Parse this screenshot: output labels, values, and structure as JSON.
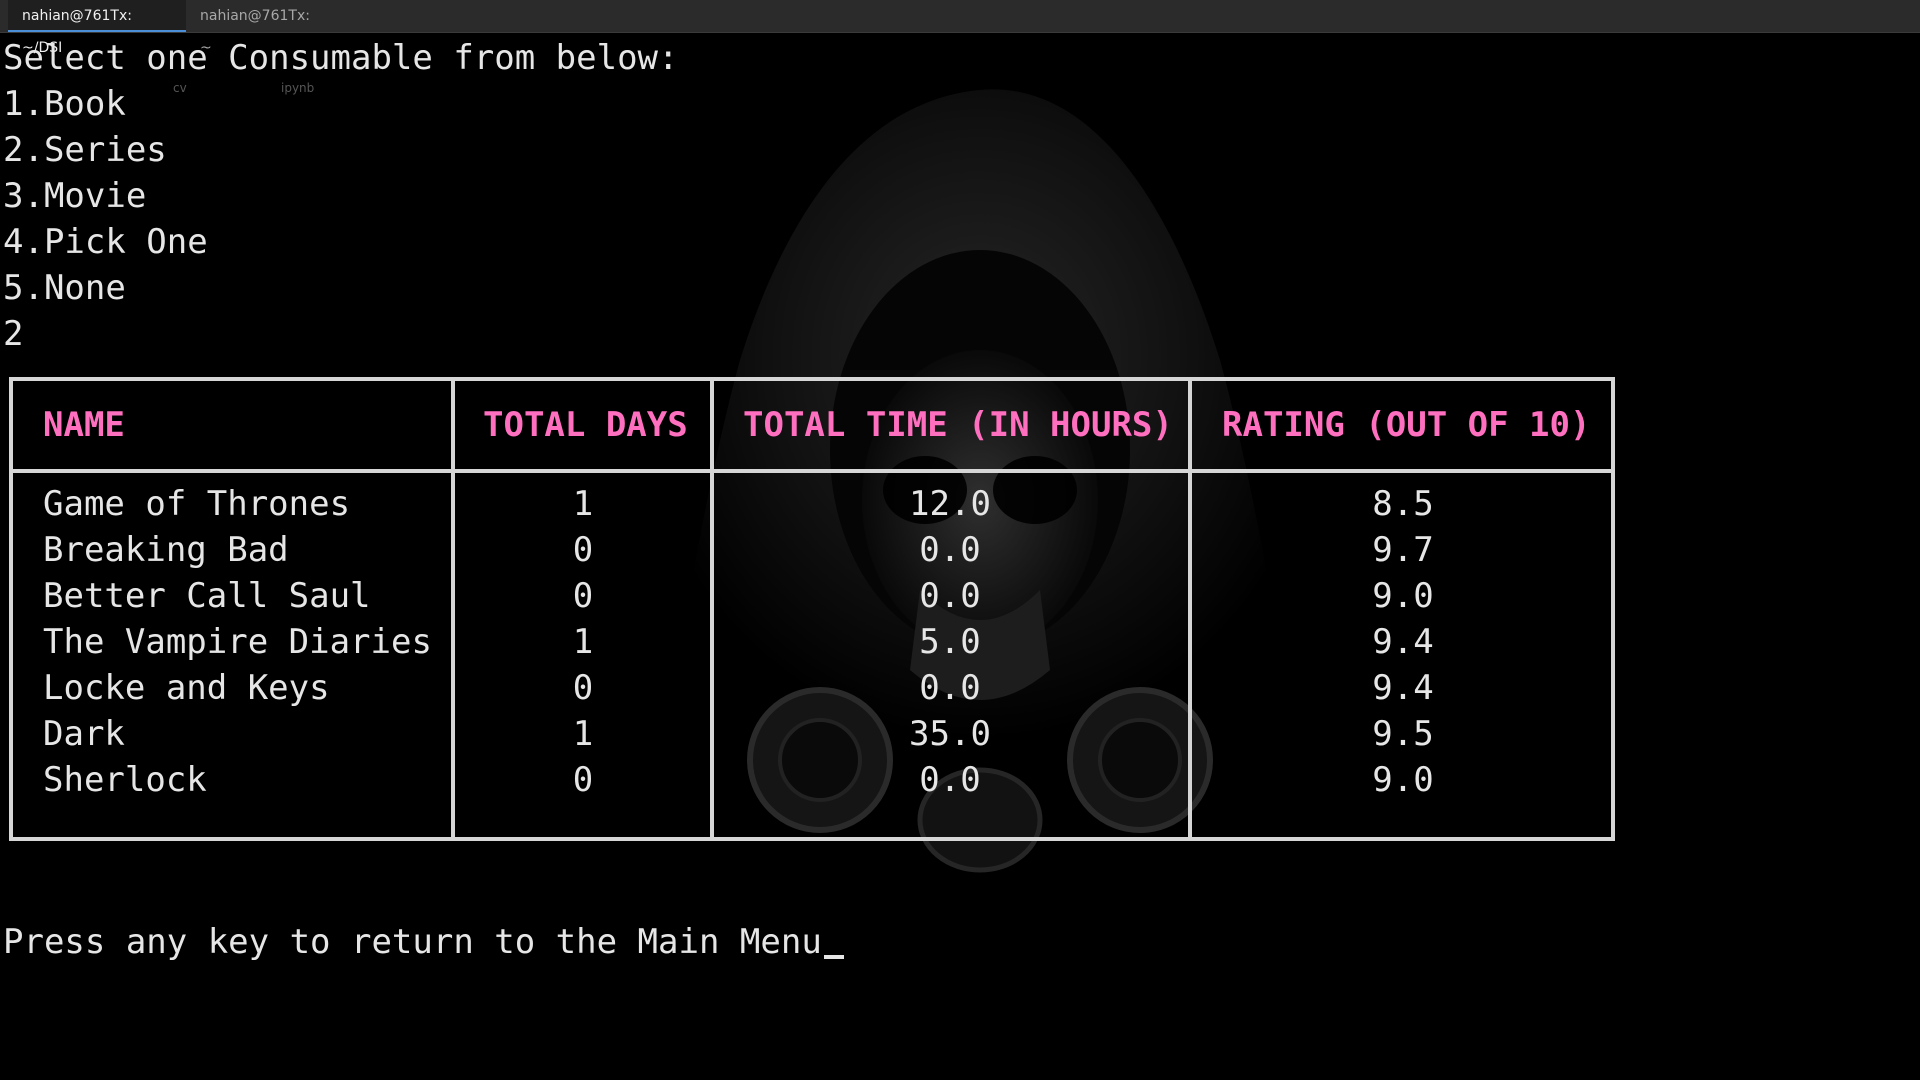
{
  "tabs": [
    {
      "label": "nahian@761Tx: ~/DSI",
      "active": true
    },
    {
      "label": "nahian@761Tx: ~",
      "active": false
    }
  ],
  "prompt": "Select one Consumable from below:",
  "options": [
    "1.Book",
    "2.Series",
    "3.Movie",
    "4.Pick One",
    "5.None"
  ],
  "user_input": "2",
  "ghost_labels": [
    "cv",
    "ipynb"
  ],
  "table": {
    "headers": [
      "NAME",
      "TOTAL DAYS",
      "TOTAL TIME (IN HOURS)",
      "RATING (OUT OF 10)"
    ],
    "rows": [
      {
        "name": "Game of Thrones",
        "days": "1",
        "hours": "12.0",
        "rating": "8.5"
      },
      {
        "name": "Breaking Bad",
        "days": "0",
        "hours": "0.0",
        "rating": "9.7"
      },
      {
        "name": "Better Call Saul",
        "days": "0",
        "hours": "0.0",
        "rating": "9.0"
      },
      {
        "name": "The Vampire Diaries",
        "days": "1",
        "hours": "5.0",
        "rating": "9.4"
      },
      {
        "name": "Locke and Keys",
        "days": "0",
        "hours": "0.0",
        "rating": "9.4"
      },
      {
        "name": "Dark",
        "days": "1",
        "hours": "35.0",
        "rating": "9.5"
      },
      {
        "name": "Sherlock",
        "days": "0",
        "hours": "0.0",
        "rating": "9.0"
      }
    ]
  },
  "footer": "Press any key to return to the Main Menu",
  "colors": {
    "header_text": "#ff6fbf",
    "table_border": "#d6d6d6",
    "background": "#000000",
    "text": "#e6e6e6",
    "active_tab_underline": "#4a8fd8"
  },
  "icons": [
    "hooded-gasmask-figure-background"
  ]
}
